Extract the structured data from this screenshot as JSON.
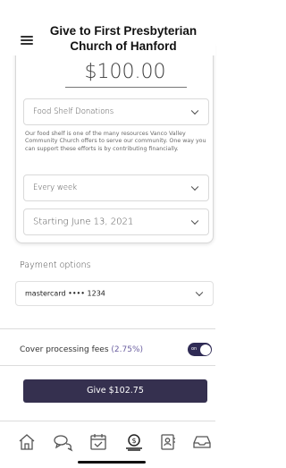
{
  "header": {
    "title": "Give to First Presbyterian Church of Hanford"
  },
  "gift": {
    "amount": "$100.00",
    "fund": "Food Shelf Donations",
    "fund_description": "Our food shelf is one of the many resources Vanco Valley Community Church offers to serve our community. One way you can support these efforts is by contributing financially.",
    "frequency": "Every week",
    "start_date": "Starting June 13, 2021"
  },
  "payment": {
    "label": "Payment options",
    "method": "mastercard •••• 1234"
  },
  "fees": {
    "label": "Cover processing fees",
    "percent": "(2.75%)",
    "toggle_state": "on",
    "toggle_enabled": true
  },
  "give_button": {
    "label": "Give $102.75"
  },
  "tabbar": {
    "items": [
      "home-icon",
      "chat-bubbles-icon",
      "calendar-check-icon",
      "give-hand-icon",
      "contact-card-icon",
      "inbox-tray-icon"
    ]
  },
  "colors": {
    "primary": "#35304f",
    "accent_text": "#6b5fa0"
  }
}
